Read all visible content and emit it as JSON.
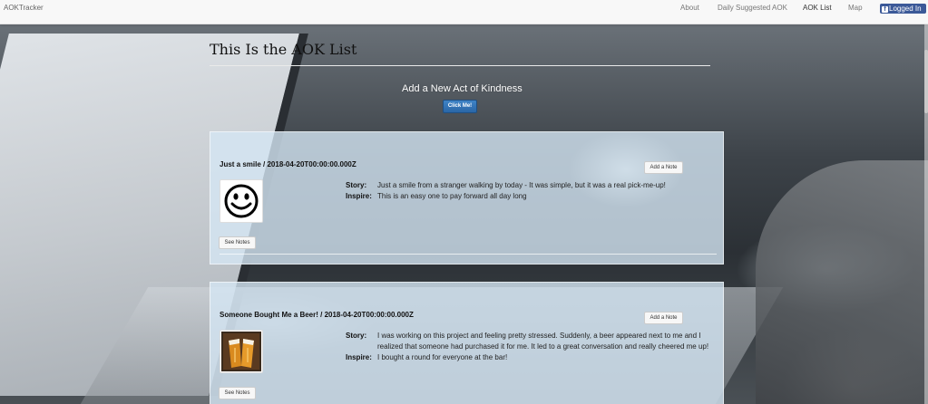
{
  "app": {
    "brand": "AOKTracker"
  },
  "nav": {
    "items": [
      {
        "label": "About"
      },
      {
        "label": "Daily Suggested AOK"
      },
      {
        "label": "AOK List"
      },
      {
        "label": "Map"
      }
    ],
    "login_label": "Logged In",
    "login_icon": "facebook-icon",
    "fb_glyph": "f"
  },
  "page": {
    "title": "This Is the AOK List",
    "add_heading": "Add a New Act of Kindness",
    "click_label": "Click Me!"
  },
  "labels": {
    "story": "Story:",
    "inspire": "Inspire:",
    "add_note": "Add a Note",
    "see_notes": "See Notes"
  },
  "cards": [
    {
      "title": "Just a smile / 2018-04-20T00:00:00.000Z",
      "image_icon": "smiley-face-icon",
      "story": "Just a smile from a stranger walking by today - It was simple, but it was a real pick-me-up!",
      "inspire": "This is an easy one to pay forward all day long"
    },
    {
      "title": "Someone Bought Me a Beer! / 2018-04-20T00:00:00.000Z",
      "image_icon": "beer-toast-icon",
      "story": "I was working on this project and feeling pretty stressed. Suddenly, a beer appeared next to me and I realized that someone had purchased it for me. It led to a great conversation and really cheered me up!",
      "inspire": "I bought a round for everyone at the bar!"
    }
  ],
  "colors": {
    "navbar_bg": "#f8f8f8",
    "card_bg": "#d4e6f4",
    "primary_button": "#337ab7",
    "facebook_blue": "#3b5998"
  }
}
